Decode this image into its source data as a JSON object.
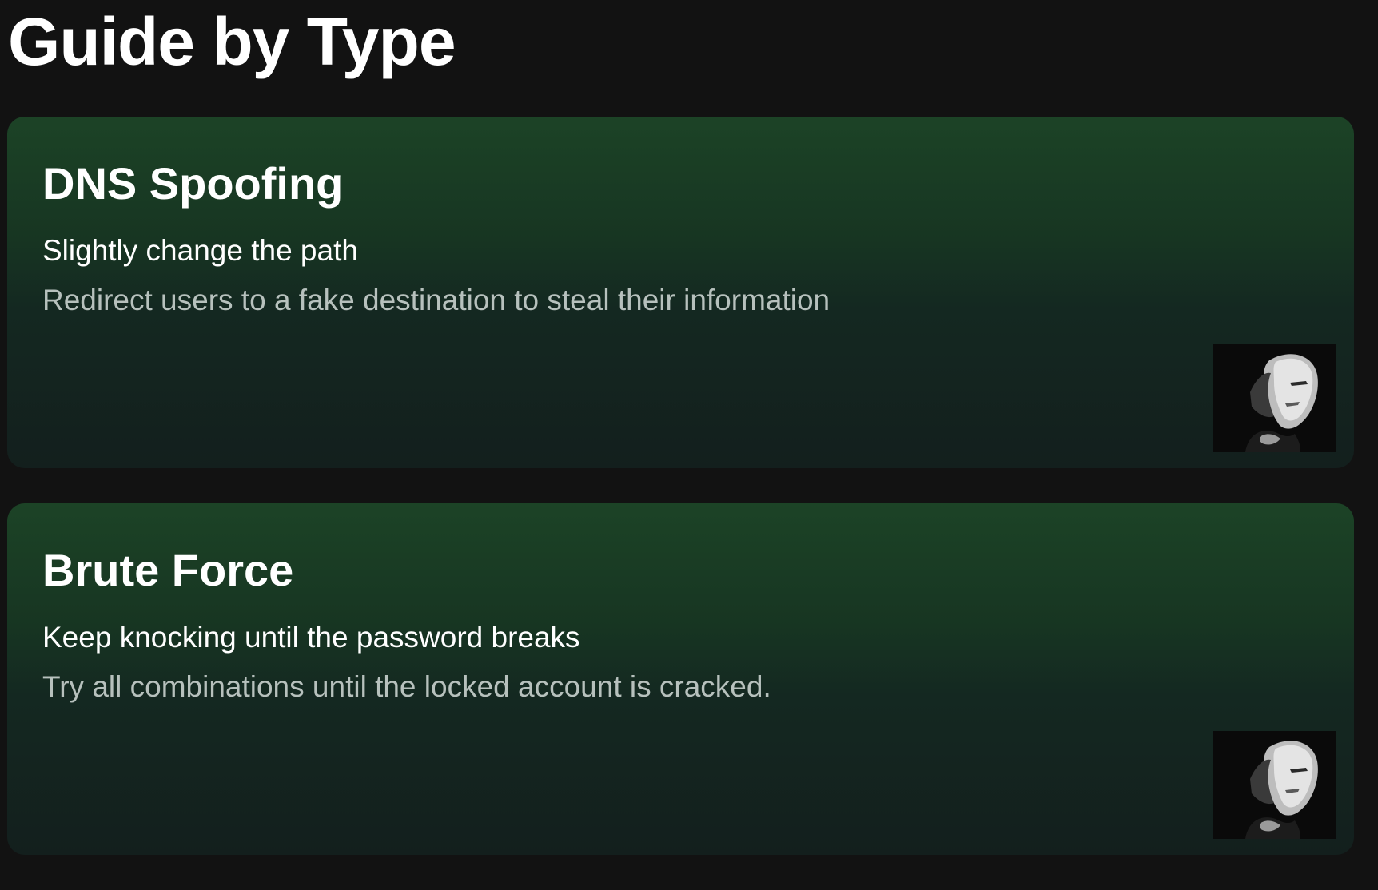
{
  "page": {
    "title": "Guide by Type"
  },
  "cards": [
    {
      "title": "DNS Spoofing",
      "subtitle": "Slightly change the path",
      "description": "Redirect users to a fake destination to steal their information",
      "thumbnail_icon": "face-portrait-icon"
    },
    {
      "title": "Brute Force",
      "subtitle": "Keep knocking until the password breaks",
      "description": "Try all combinations until the locked account is cracked.",
      "thumbnail_icon": "face-portrait-icon"
    }
  ],
  "colors": {
    "background": "#121212",
    "card_gradient_top": "#1c4326",
    "card_gradient_bottom": "#131f1d",
    "title_text": "#ffffff",
    "description_text": "#b7c1bd"
  }
}
